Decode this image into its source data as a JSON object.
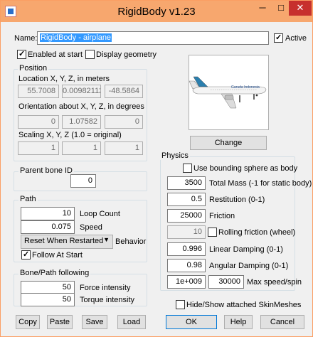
{
  "window": {
    "title": "RigidBody v1.23",
    "minimize": "─",
    "maximize": "□",
    "close": "✕",
    "close_color": "#c7302d",
    "titlebar_color": "#f7a76e"
  },
  "name": {
    "label": "Name:",
    "value": "RigidBody - airplane",
    "active_label": "Active",
    "active": true
  },
  "enabled": {
    "label": "Enabled at start",
    "checked": true
  },
  "display_geometry": {
    "label": "Display geometry",
    "checked": false
  },
  "position": {
    "title": "Position",
    "location_label": "Location X, Y, Z, in meters",
    "location": [
      "55.7008",
      "0.00982112",
      "-48.5864"
    ],
    "orientation_label": "Orientation about X, Y, Z, in degrees",
    "orientation": [
      "0",
      "1.07582",
      "0"
    ],
    "scaling_label": "Scaling X, Y, Z (1.0 = original)",
    "scaling": [
      "1",
      "1",
      "1"
    ]
  },
  "preview": {
    "caption": "Garuda Indonesia",
    "change_label": "Change"
  },
  "parent_bone": {
    "label": "Parent bone ID",
    "value": "0"
  },
  "path": {
    "title": "Path",
    "loop_count": "10",
    "loop_count_label": "Loop Count",
    "speed": "0.075",
    "speed_label": "Speed",
    "behavior": "Reset When Restarted",
    "behavior_label": "Behavior",
    "follow_label": "Follow At Start",
    "follow": true
  },
  "bone_path": {
    "title": "Bone/Path following",
    "force": "50",
    "force_label": "Force intensity",
    "torque": "50",
    "torque_label": "Torque intensity"
  },
  "physics": {
    "title": "Physics",
    "bounding_sphere_label": "Use bounding sphere as body",
    "total_mass": "3500",
    "total_mass_label": "Total Mass (-1 for static body)",
    "restitution": "0.5",
    "restitution_label": "Restitution (0-1)",
    "friction": "25000",
    "friction_label": "Friction",
    "rolling": "10",
    "rolling_label": "Rolling friction (wheel)",
    "linear_damping": "0.996",
    "linear_damping_label": "Linear Damping (0-1)",
    "angular_damping": "0.98",
    "angular_damping_label": "Angular Damping (0-1)",
    "max_speed": "1e+009",
    "max_spin": "30000",
    "max_label": "Max speed/spin"
  },
  "hide_show_label": "Hide/Show attached SkinMeshes",
  "buttons": {
    "copy": "Copy",
    "paste": "Paste",
    "save": "Save",
    "load": "Load",
    "ok": "OK",
    "help": "Help",
    "cancel": "Cancel"
  }
}
